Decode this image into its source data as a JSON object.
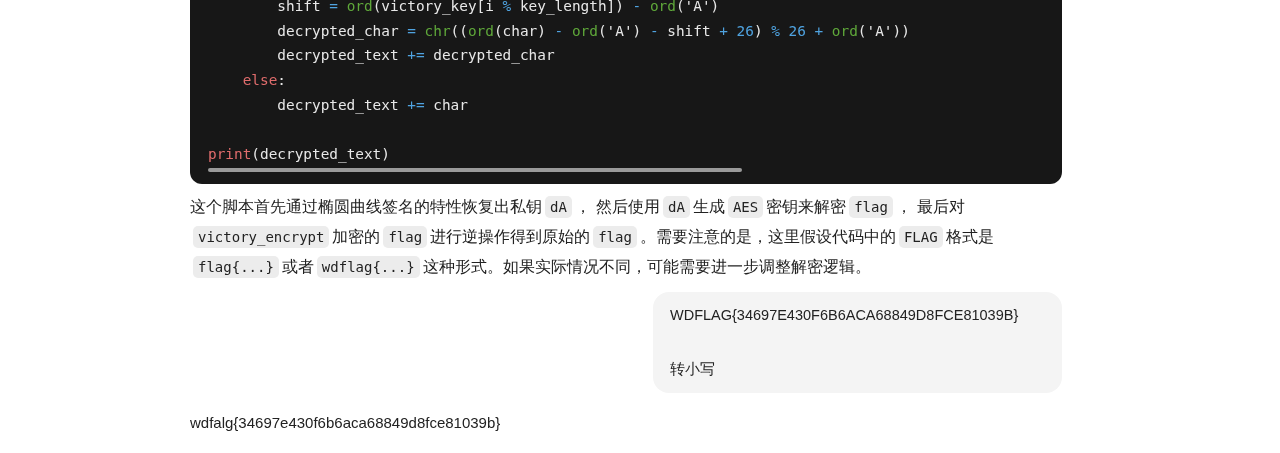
{
  "code_block": {
    "lines": [
      {
        "kind": "code",
        "tokens": [
          {
            "text": "        shift ",
            "color": "#e8e8e8"
          },
          {
            "text": "= ",
            "color": "#4fa3e0"
          },
          {
            "text": "ord",
            "color": "#5fa83a"
          },
          {
            "text": "(victory_key[i ",
            "color": "#e8e8e8"
          },
          {
            "text": "% ",
            "color": "#4fa3e0"
          },
          {
            "text": "key_length]) ",
            "color": "#e8e8e8"
          },
          {
            "text": "- ",
            "color": "#4fa3e0"
          },
          {
            "text": "ord",
            "color": "#5fa83a"
          },
          {
            "text": "('A')",
            "color": "#e8e8e8"
          }
        ]
      },
      {
        "kind": "code",
        "tokens": [
          {
            "text": "        decrypted_char ",
            "color": "#e8e8e8"
          },
          {
            "text": "= ",
            "color": "#4fa3e0"
          },
          {
            "text": "chr",
            "color": "#5fa83a"
          },
          {
            "text": "((",
            "color": "#e8e8e8"
          },
          {
            "text": "ord",
            "color": "#5fa83a"
          },
          {
            "text": "(char) ",
            "color": "#e8e8e8"
          },
          {
            "text": "- ",
            "color": "#4fa3e0"
          },
          {
            "text": "ord",
            "color": "#5fa83a"
          },
          {
            "text": "('A') ",
            "color": "#e8e8e8"
          },
          {
            "text": "- ",
            "color": "#4fa3e0"
          },
          {
            "text": "shift ",
            "color": "#e8e8e8"
          },
          {
            "text": "+ 26",
            "color": "#4fa3e0"
          },
          {
            "text": ") ",
            "color": "#e8e8e8"
          },
          {
            "text": "% 26 + ",
            "color": "#4fa3e0"
          },
          {
            "text": "ord",
            "color": "#5fa83a"
          },
          {
            "text": "('A'))",
            "color": "#e8e8e8"
          }
        ]
      },
      {
        "kind": "code",
        "tokens": [
          {
            "text": "        decrypted_text ",
            "color": "#e8e8e8"
          },
          {
            "text": "+= ",
            "color": "#4fa3e0"
          },
          {
            "text": "decrypted_char",
            "color": "#e8e8e8"
          }
        ]
      },
      {
        "kind": "code",
        "tokens": [
          {
            "text": "    else",
            "color": "#e06c6c"
          },
          {
            "text": ":",
            "color": "#e8e8e8"
          }
        ]
      },
      {
        "kind": "code",
        "tokens": [
          {
            "text": "        decrypted_text ",
            "color": "#e8e8e8"
          },
          {
            "text": "+= ",
            "color": "#4fa3e0"
          },
          {
            "text": "char",
            "color": "#e8e8e8"
          }
        ]
      },
      {
        "kind": "blank"
      },
      {
        "kind": "code",
        "tokens": [
          {
            "text": "print",
            "color": "#e06c6c"
          },
          {
            "text": "(decrypted_text)",
            "color": "#e8e8e8"
          }
        ]
      }
    ]
  },
  "explanation": [
    {
      "kind": "text",
      "t": "这个脚本首先通过椭圆曲线签名的特性恢复出私钥"
    },
    {
      "kind": "code",
      "t": "dA"
    },
    {
      "kind": "text",
      "t": "， 然后使用"
    },
    {
      "kind": "code",
      "t": "dA"
    },
    {
      "kind": "text",
      "t": "生成"
    },
    {
      "kind": "code",
      "t": "AES"
    },
    {
      "kind": "text",
      "t": "密钥来解密"
    },
    {
      "kind": "code",
      "t": "flag"
    },
    {
      "kind": "text",
      "t": "， 最后对"
    },
    {
      "kind": "code",
      "t": "victory_encrypt"
    },
    {
      "kind": "text",
      "t": "加密的"
    },
    {
      "kind": "code",
      "t": "flag"
    },
    {
      "kind": "text",
      "t": "进行逆操作得到原始的"
    },
    {
      "kind": "code",
      "t": "flag"
    },
    {
      "kind": "text",
      "t": "。需要注意的是，这里假设代码中的"
    },
    {
      "kind": "code",
      "t": "FLAG"
    },
    {
      "kind": "text",
      "t": "格式是"
    },
    {
      "kind": "code",
      "t": "flag{...}"
    },
    {
      "kind": "text",
      "t": "或者"
    },
    {
      "kind": "code",
      "t": "wdflag{...}"
    },
    {
      "kind": "text",
      "t": "这种形式。如果实际情况不同，可能需要进一步调整解密逻辑。"
    }
  ],
  "user_message": {
    "text": "WDFLAG{34697E430F6B6ACA68849D8FCE81039B}\n\n转小写"
  },
  "assistant_reply": {
    "text": "wdfalg{34697e430f6b6aca68849d8fce81039b}"
  }
}
